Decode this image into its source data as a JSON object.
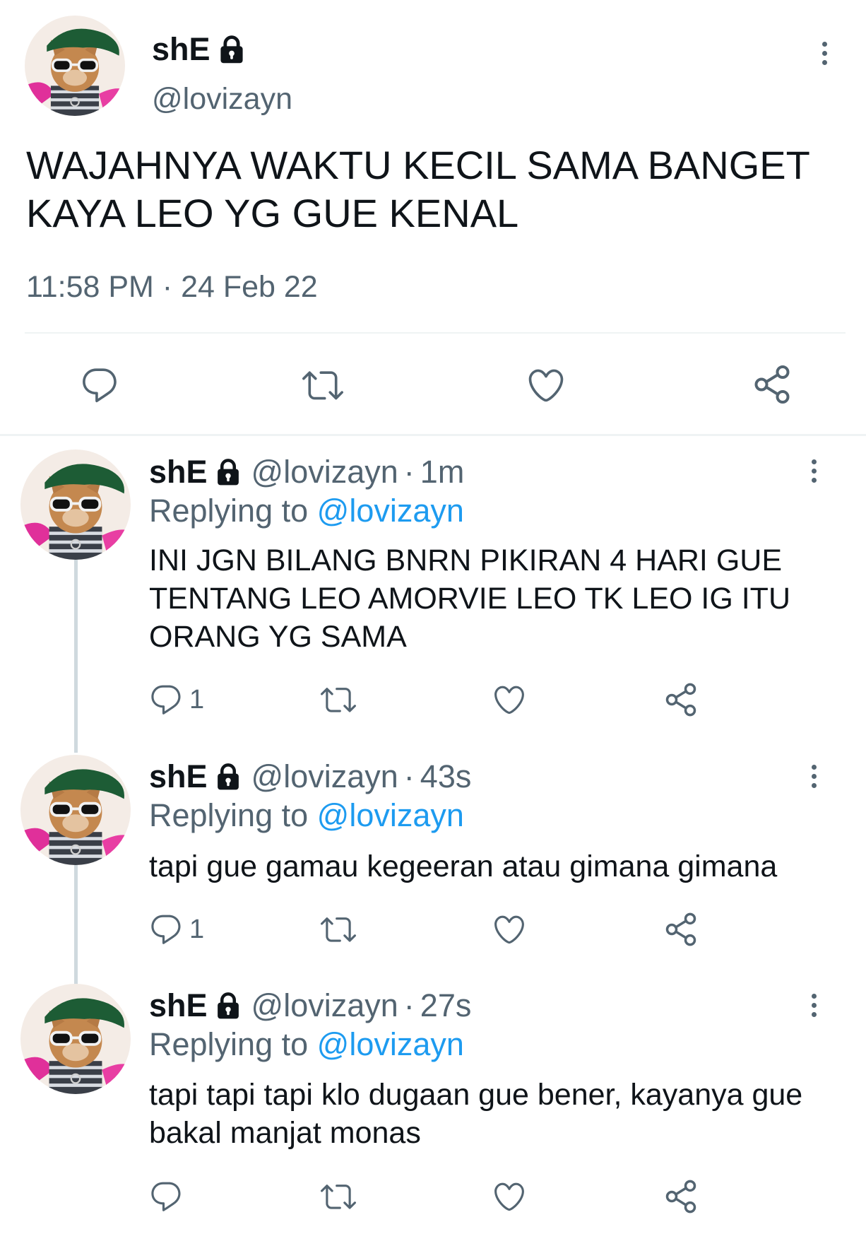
{
  "main_tweet": {
    "display_name": "shE",
    "handle": "@lovizayn",
    "text": "WAJAHNYA WAKTU KECIL SAMA BANGET KAYA LEO YG GUE KENAL",
    "timestamp": "11:58 PM · 24 Feb 22",
    "actions": {
      "reply_icon": "comment-icon",
      "retweet_icon": "retweet-icon",
      "like_icon": "heart-icon",
      "share_icon": "share-icon"
    }
  },
  "replies": [
    {
      "display_name": "shE",
      "handle": "@lovizayn",
      "time": "1m",
      "replying_prefix": "Replying to",
      "replying_to": "@lovizayn",
      "text": "INI JGN BILANG BNRN PIKIRAN 4 HARI GUE TENTANG LEO AMORVIE LEO TK LEO IG ITU ORANG YG SAMA",
      "reply_count": "1"
    },
    {
      "display_name": "shE",
      "handle": "@lovizayn",
      "time": "43s",
      "replying_prefix": "Replying to",
      "replying_to": "@lovizayn",
      "text": "tapi gue gamau kegeeran atau gimana gimana",
      "reply_count": "1"
    },
    {
      "display_name": "shE",
      "handle": "@lovizayn",
      "time": "27s",
      "replying_prefix": "Replying to",
      "replying_to": "@lovizayn",
      "text": "tapi tapi tapi klo dugaan gue bener, kayanya gue bakal manjat monas",
      "reply_count": ""
    }
  ],
  "colors": {
    "text": "#0f1419",
    "secondary": "#536471",
    "link": "#1d9bf0",
    "divider": "#eff3f4",
    "thread_line": "#cfd9de"
  }
}
